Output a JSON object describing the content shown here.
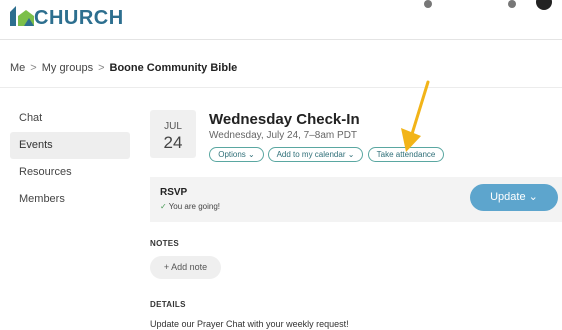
{
  "header": {
    "logo_text": "CHURCH",
    "logo_color": "#2d6f8f"
  },
  "breadcrumb": {
    "items": [
      "Me",
      "My groups",
      "Boone Community Bible"
    ],
    "separator": ">"
  },
  "sidebar": {
    "items": [
      {
        "label": "Chat",
        "active": false
      },
      {
        "label": "Events",
        "active": true
      },
      {
        "label": "Resources",
        "active": false
      },
      {
        "label": "Members",
        "active": false
      }
    ]
  },
  "event": {
    "month": "JUL",
    "day": "24",
    "title": "Wednesday Check-In",
    "time": "Wednesday, July 24, 7–8am PDT",
    "actions": [
      {
        "label": "Options",
        "has_chevron": true
      },
      {
        "label": "Add to my calendar",
        "has_chevron": true
      },
      {
        "label": "Take attendance",
        "has_chevron": false
      }
    ],
    "action_color": "#5aa7a1"
  },
  "rsvp": {
    "label": "RSVP",
    "status": "You are going!",
    "status_icon": "check-icon",
    "button_label": "Update",
    "button_color": "#5da5cd"
  },
  "notes": {
    "heading": "NOTES",
    "add_label": "+ Add note"
  },
  "details": {
    "heading": "DETAILS",
    "text": "Update our Prayer Chat with your weekly request!"
  },
  "annotation": {
    "arrow_color": "#f2b418"
  }
}
